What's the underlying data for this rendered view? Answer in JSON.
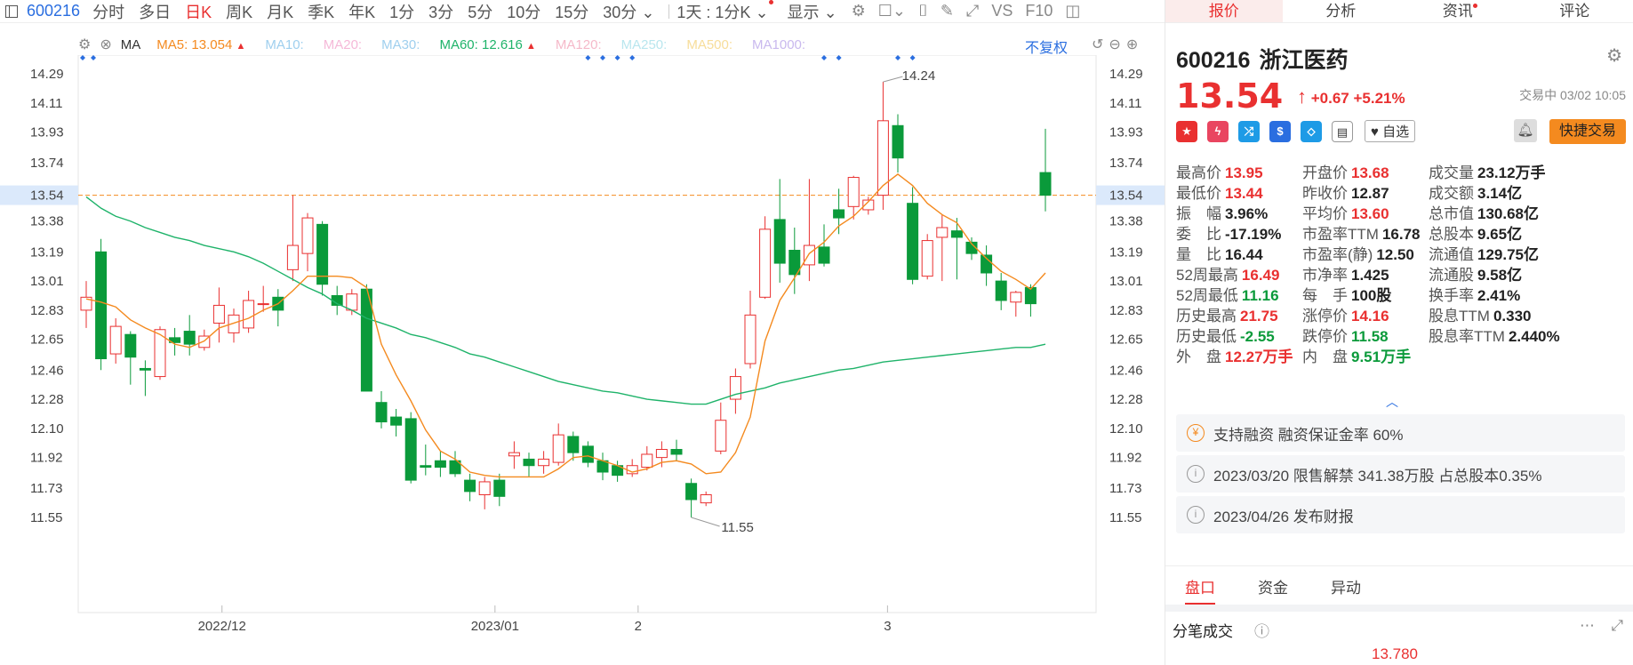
{
  "toolbar": {
    "code": "600216",
    "tabs": [
      "分时",
      "多日",
      "日K",
      "周K",
      "月K",
      "季K",
      "年K",
      "1分",
      "3分",
      "5分",
      "10分",
      "15分"
    ],
    "active_tab": "日K",
    "tab_30": "30分",
    "tab_multi": "1天 : 1分K",
    "display": "显示",
    "vs": "VS",
    "f10": "F10"
  },
  "ma_bar": {
    "label": "MA",
    "ma5": "MA5: 13.054",
    "ma10": "MA10:",
    "ma20": "MA20:",
    "ma30": "MA30:",
    "ma60": "MA60: 12.616",
    "ma120": "MA120:",
    "ma250": "MA250:",
    "ma500": "MA500:",
    "ma1000": "MA1000:",
    "fuquan": "不复权",
    "colors": {
      "ma5": "#f48a1f",
      "ma10": "#9fcfee",
      "ma20": "#f5b9d8",
      "ma30": "#9fcfee",
      "ma60": "#1fb36a",
      "ma120": "#f5b9c9",
      "ma250": "#b9e6ee",
      "ma500": "#f7dd9a",
      "ma1000": "#c9b9ee"
    }
  },
  "chart_data": {
    "type": "candlestick",
    "y_ticks": [
      "14.29",
      "14.11",
      "13.93",
      "13.74",
      "13.54",
      "13.38",
      "13.19",
      "13.01",
      "12.83",
      "12.65",
      "12.46",
      "12.28",
      "12.10",
      "11.92",
      "11.73",
      "11.55"
    ],
    "ylim": [
      11.5,
      14.35
    ],
    "x_labels": [
      "2022/12",
      "2023/01",
      "2",
      "3"
    ],
    "current_price": "13.54",
    "high_label": "14.24",
    "low_label": "11.55",
    "candles": [
      {
        "o": 12.83,
        "c": 12.91,
        "h": 13.01,
        "l": 12.72
      },
      {
        "o": 13.19,
        "c": 12.53,
        "h": 13.27,
        "l": 12.46
      },
      {
        "o": 12.56,
        "c": 12.73,
        "h": 12.78,
        "l": 12.5
      },
      {
        "o": 12.68,
        "c": 12.54,
        "h": 12.7,
        "l": 12.37
      },
      {
        "o": 12.47,
        "c": 12.46,
        "h": 12.52,
        "l": 12.3
      },
      {
        "o": 12.42,
        "c": 12.71,
        "h": 12.73,
        "l": 12.4
      },
      {
        "o": 12.66,
        "c": 12.63,
        "h": 12.72,
        "l": 12.55
      },
      {
        "o": 12.7,
        "c": 12.62,
        "h": 12.8,
        "l": 12.55
      },
      {
        "o": 12.6,
        "c": 12.67,
        "h": 12.71,
        "l": 12.58
      },
      {
        "o": 12.75,
        "c": 12.86,
        "h": 12.97,
        "l": 12.63
      },
      {
        "o": 12.69,
        "c": 12.8,
        "h": 12.84,
        "l": 12.63
      },
      {
        "o": 12.72,
        "c": 12.89,
        "h": 12.95,
        "l": 12.69
      },
      {
        "o": 12.87,
        "c": 12.87,
        "h": 12.98,
        "l": 12.82
      },
      {
        "o": 12.91,
        "c": 12.83,
        "h": 12.96,
        "l": 12.73
      },
      {
        "o": 13.08,
        "c": 13.23,
        "h": 13.54,
        "l": 13.01
      },
      {
        "o": 13.18,
        "c": 13.4,
        "h": 13.43,
        "l": 13.07
      },
      {
        "o": 13.36,
        "c": 12.99,
        "h": 13.38,
        "l": 12.92
      },
      {
        "o": 12.92,
        "c": 12.86,
        "h": 12.98,
        "l": 12.8
      },
      {
        "o": 12.83,
        "c": 12.93,
        "h": 12.96,
        "l": 12.8
      },
      {
        "o": 12.96,
        "c": 12.33,
        "h": 12.99,
        "l": 12.33
      },
      {
        "o": 12.26,
        "c": 12.14,
        "h": 12.33,
        "l": 12.1
      },
      {
        "o": 12.17,
        "c": 12.12,
        "h": 12.22,
        "l": 12.05
      },
      {
        "o": 12.16,
        "c": 11.78,
        "h": 12.2,
        "l": 11.76
      },
      {
        "o": 11.87,
        "c": 11.86,
        "h": 12.0,
        "l": 11.81
      },
      {
        "o": 11.9,
        "c": 11.86,
        "h": 11.96,
        "l": 11.8
      },
      {
        "o": 11.9,
        "c": 11.82,
        "h": 11.96,
        "l": 11.8
      },
      {
        "o": 11.78,
        "c": 11.71,
        "h": 11.82,
        "l": 11.65
      },
      {
        "o": 11.69,
        "c": 11.77,
        "h": 11.8,
        "l": 11.6
      },
      {
        "o": 11.78,
        "c": 11.68,
        "h": 11.82,
        "l": 11.62
      },
      {
        "o": 11.93,
        "c": 11.95,
        "h": 12.02,
        "l": 11.85
      },
      {
        "o": 11.91,
        "c": 11.87,
        "h": 11.95,
        "l": 11.8
      },
      {
        "o": 11.87,
        "c": 11.91,
        "h": 11.96,
        "l": 11.82
      },
      {
        "o": 11.89,
        "c": 12.06,
        "h": 12.13,
        "l": 11.87
      },
      {
        "o": 12.05,
        "c": 11.95,
        "h": 12.08,
        "l": 11.9
      },
      {
        "o": 11.99,
        "c": 11.89,
        "h": 12.02,
        "l": 11.86
      },
      {
        "o": 11.9,
        "c": 11.83,
        "h": 11.95,
        "l": 11.78
      },
      {
        "o": 11.87,
        "c": 11.81,
        "h": 11.9,
        "l": 11.77
      },
      {
        "o": 11.82,
        "c": 11.87,
        "h": 11.91,
        "l": 11.8
      },
      {
        "o": 11.86,
        "c": 11.94,
        "h": 11.99,
        "l": 11.84
      },
      {
        "o": 11.92,
        "c": 11.97,
        "h": 12.02,
        "l": 11.86
      },
      {
        "o": 11.97,
        "c": 11.94,
        "h": 12.03,
        "l": 11.9
      },
      {
        "o": 11.76,
        "c": 11.66,
        "h": 11.79,
        "l": 11.55
      },
      {
        "o": 11.64,
        "c": 11.69,
        "h": 11.71,
        "l": 11.62
      },
      {
        "o": 11.96,
        "c": 12.15,
        "h": 12.26,
        "l": 11.94
      },
      {
        "o": 12.28,
        "c": 12.42,
        "h": 12.47,
        "l": 12.19
      },
      {
        "o": 12.5,
        "c": 12.8,
        "h": 12.95,
        "l": 12.47
      },
      {
        "o": 12.91,
        "c": 13.33,
        "h": 13.41,
        "l": 12.9
      },
      {
        "o": 13.39,
        "c": 13.12,
        "h": 13.64,
        "l": 13.0
      },
      {
        "o": 13.2,
        "c": 13.05,
        "h": 13.34,
        "l": 12.93
      },
      {
        "o": 13.11,
        "c": 13.23,
        "h": 13.64,
        "l": 13.01
      },
      {
        "o": 13.22,
        "c": 13.12,
        "h": 13.36,
        "l": 13.1
      },
      {
        "o": 13.45,
        "c": 13.4,
        "h": 13.58,
        "l": 13.3
      },
      {
        "o": 13.47,
        "c": 13.65,
        "h": 13.66,
        "l": 13.39
      },
      {
        "o": 13.45,
        "c": 13.51,
        "h": 13.53,
        "l": 13.42
      },
      {
        "o": 13.54,
        "c": 14.0,
        "h": 14.24,
        "l": 13.45
      },
      {
        "o": 13.97,
        "c": 13.77,
        "h": 14.04,
        "l": 13.68
      },
      {
        "o": 13.49,
        "c": 13.02,
        "h": 13.59,
        "l": 12.99
      },
      {
        "o": 13.04,
        "c": 13.26,
        "h": 13.3,
        "l": 13.02
      },
      {
        "o": 13.28,
        "c": 13.34,
        "h": 13.42,
        "l": 13.01
      },
      {
        "o": 13.32,
        "c": 13.28,
        "h": 13.4,
        "l": 13.02
      },
      {
        "o": 13.25,
        "c": 13.18,
        "h": 13.28,
        "l": 13.14
      },
      {
        "o": 13.17,
        "c": 13.06,
        "h": 13.23,
        "l": 12.98
      },
      {
        "o": 13.01,
        "c": 12.89,
        "h": 13.06,
        "l": 12.83
      },
      {
        "o": 12.88,
        "c": 12.94,
        "h": 12.95,
        "l": 12.79
      },
      {
        "o": 12.97,
        "c": 12.87,
        "h": 12.99,
        "l": 12.79
      },
      {
        "o": 13.68,
        "c": 13.54,
        "h": 13.95,
        "l": 13.44
      }
    ],
    "ma5": [
      12.9,
      12.88,
      12.85,
      12.77,
      12.72,
      12.68,
      12.62,
      12.6,
      12.64,
      12.72,
      12.75,
      12.78,
      12.83,
      12.87,
      12.95,
      13.04,
      13.04,
      13.04,
      13.03,
      12.97,
      12.62,
      12.43,
      12.27,
      12.09,
      11.96,
      11.91,
      11.83,
      11.81,
      11.8,
      11.8,
      11.8,
      11.8,
      11.85,
      11.92,
      11.93,
      11.9,
      11.87,
      11.83,
      11.85,
      11.89,
      11.9,
      11.88,
      11.82,
      11.83,
      11.95,
      12.17,
      12.64,
      12.89,
      13.03,
      13.18,
      13.25,
      13.35,
      13.41,
      13.5,
      13.6,
      13.67,
      13.6,
      13.49,
      13.42,
      13.37,
      13.24,
      13.15,
      13.07,
      13.02,
      12.96,
      13.06
    ],
    "ma60": [
      13.53,
      13.46,
      13.41,
      13.38,
      13.34,
      13.31,
      13.28,
      13.26,
      13.23,
      13.21,
      13.19,
      13.16,
      13.12,
      13.07,
      13.02,
      12.97,
      12.93,
      12.87,
      12.83,
      12.78,
      12.75,
      12.72,
      12.68,
      12.66,
      12.63,
      12.6,
      12.56,
      12.54,
      12.51,
      12.48,
      12.45,
      12.42,
      12.39,
      12.37,
      12.35,
      12.33,
      12.32,
      12.3,
      12.28,
      12.27,
      12.26,
      12.25,
      12.25,
      12.28,
      12.31,
      12.33,
      12.35,
      12.38,
      12.4,
      12.42,
      12.44,
      12.46,
      12.47,
      12.49,
      12.51,
      12.52,
      12.53,
      12.54,
      12.55,
      12.56,
      12.57,
      12.58,
      12.59,
      12.6,
      12.6,
      12.62
    ]
  },
  "stock": {
    "code": "600216",
    "name": "浙江医药",
    "price": "13.54",
    "change": "+0.67",
    "change_pct": "+5.21%",
    "status": "交易中 03/02 10:05",
    "watch_label": "自选",
    "quick_trade": "快捷交易"
  },
  "right_tabs": [
    "报价",
    "分析",
    "资讯",
    "评论"
  ],
  "quotes": [
    [
      {
        "k": "最高价",
        "v": "13.95",
        "c": "red"
      },
      {
        "k": "开盘价",
        "v": "13.68",
        "c": "red"
      },
      {
        "k": "成交量",
        "v": "23.12万手",
        "c": "blk"
      }
    ],
    [
      {
        "k": "最低价",
        "v": "13.44",
        "c": "red"
      },
      {
        "k": "昨收价",
        "v": "12.87",
        "c": "blk"
      },
      {
        "k": "成交额",
        "v": "3.14亿",
        "c": "blk"
      }
    ],
    [
      {
        "k": "振　幅",
        "v": "3.96%",
        "c": "blk"
      },
      {
        "k": "平均价",
        "v": "13.60",
        "c": "red"
      },
      {
        "k": "总市值",
        "v": "130.68亿",
        "c": "blk"
      }
    ],
    [
      {
        "k": "委　比",
        "v": "-17.19%",
        "c": "blk"
      },
      {
        "k": "市盈率TTM",
        "v": "16.78",
        "c": "blk"
      },
      {
        "k": "总股本",
        "v": "9.65亿",
        "c": "blk"
      }
    ],
    [
      {
        "k": "量　比",
        "v": "16.44",
        "c": "blk"
      },
      {
        "k": "市盈率(静)",
        "v": "12.50",
        "c": "blk"
      },
      {
        "k": "流通值",
        "v": "129.75亿",
        "c": "blk"
      }
    ],
    [
      {
        "k": "52周最高",
        "v": "16.49",
        "c": "red"
      },
      {
        "k": "市净率",
        "v": "1.425",
        "c": "blk"
      },
      {
        "k": "流通股",
        "v": "9.58亿",
        "c": "blk"
      }
    ],
    [
      {
        "k": "52周最低",
        "v": "11.16",
        "c": "grn"
      },
      {
        "k": "每　手",
        "v": "100股",
        "c": "blk"
      },
      {
        "k": "换手率",
        "v": "2.41%",
        "c": "blk"
      }
    ],
    [
      {
        "k": "历史最高",
        "v": "21.75",
        "c": "red"
      },
      {
        "k": "涨停价",
        "v": "14.16",
        "c": "red"
      },
      {
        "k": "股息TTM",
        "v": "0.330",
        "c": "blk"
      }
    ],
    [
      {
        "k": "历史最低",
        "v": "-2.55",
        "c": "grn"
      },
      {
        "k": "跌停价",
        "v": "11.58",
        "c": "grn"
      },
      {
        "k": "股息率TTM",
        "v": "2.440%",
        "c": "blk"
      }
    ],
    [
      {
        "k": "外　盘",
        "v": "12.27万手",
        "c": "red"
      },
      {
        "k": "内　盘",
        "v": "9.51万手",
        "c": "grn"
      }
    ]
  ],
  "notices": [
    {
      "text": "支持融资 融资保证金率 60%"
    },
    {
      "text": "2023/03/20  限售解禁 341.38万股 占总股本0.35%"
    },
    {
      "text": "2023/04/26  发布财报"
    }
  ],
  "bottom_tabs": [
    "盘口",
    "资金",
    "异动"
  ],
  "deals": {
    "title": "分笔成交",
    "price": "13.780"
  },
  "colors": {
    "up": "#e93030",
    "down": "#0a9a3a",
    "accent": "#2a6ee0",
    "ma5": "#f48a1f",
    "ma60": "#1fb36a"
  }
}
